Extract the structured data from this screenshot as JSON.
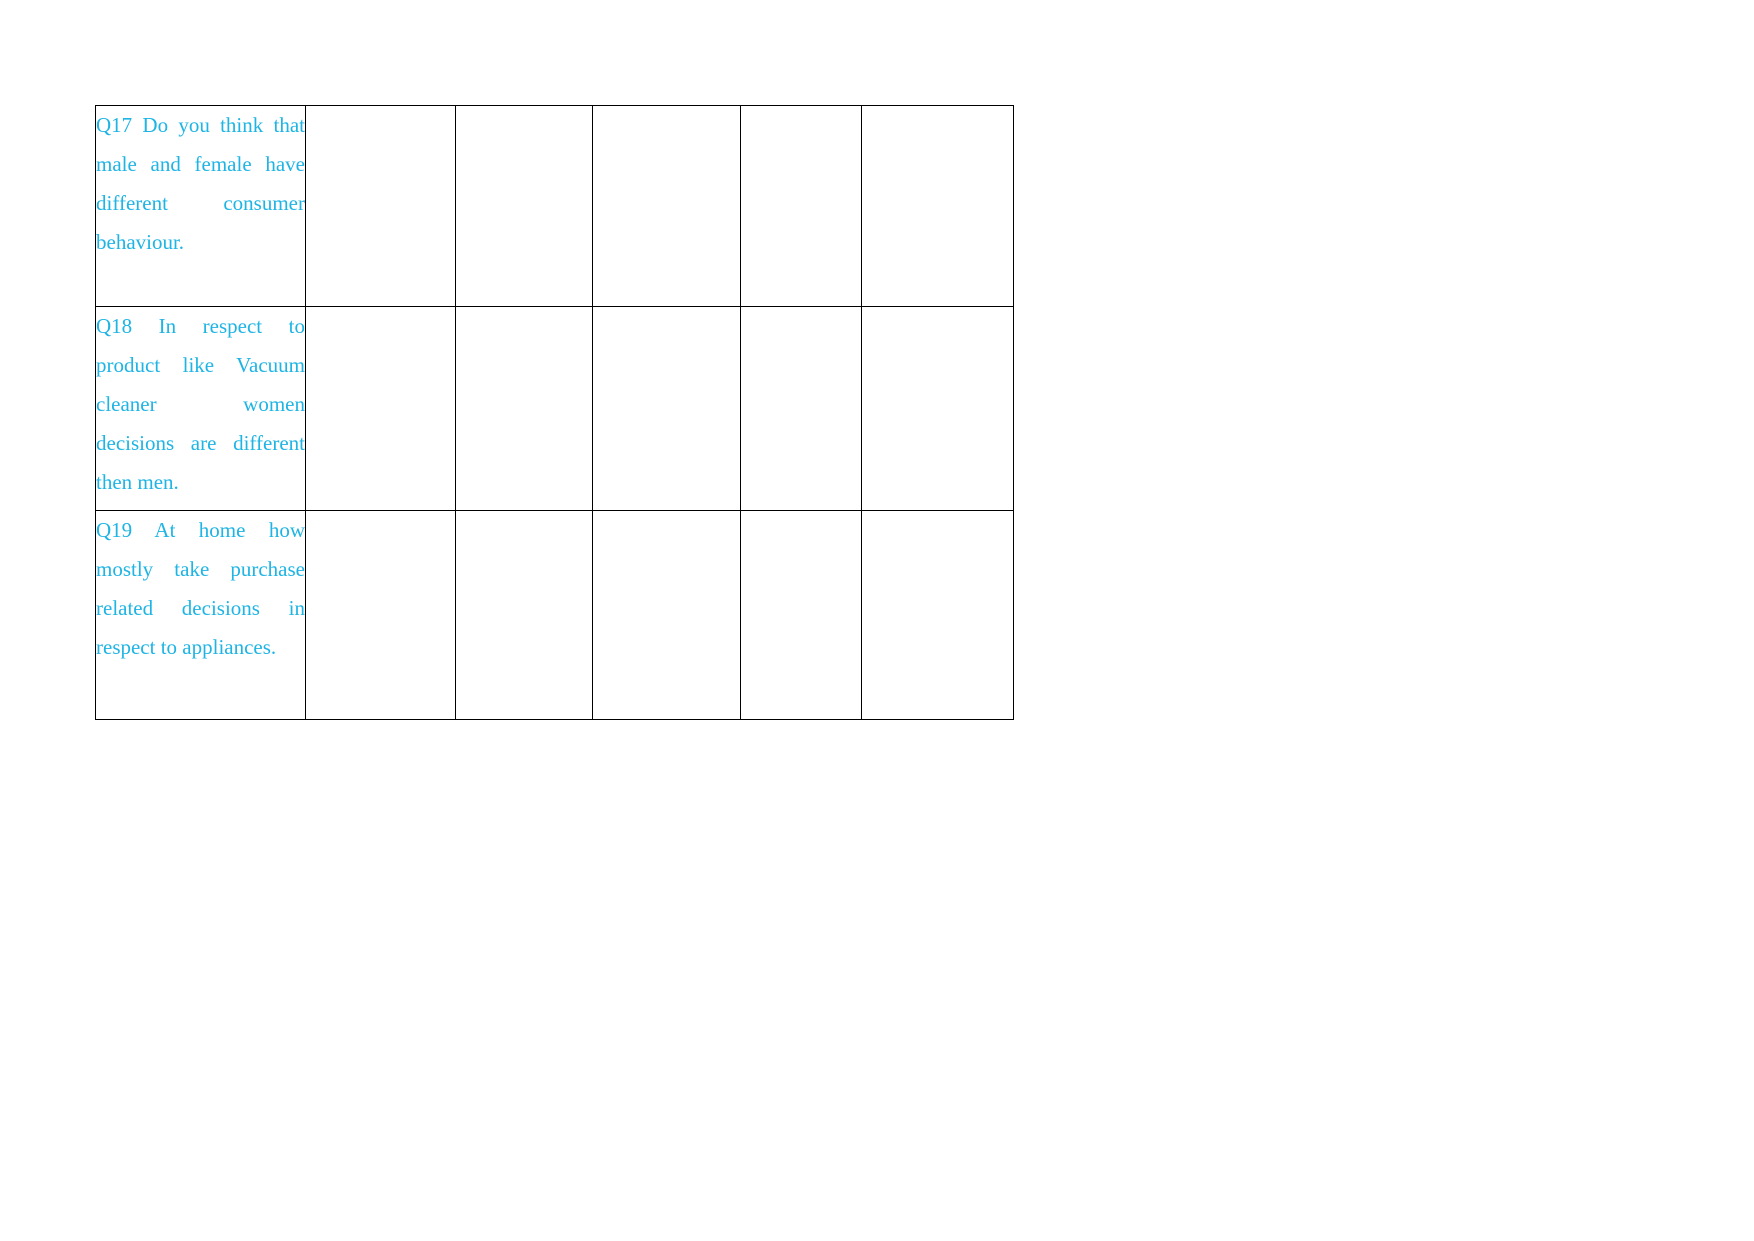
{
  "document": {
    "page_background": "#ffffff",
    "text_color": "#1EB4E4",
    "border_color": "#000000"
  },
  "table": {
    "name": "questionnaire-table",
    "column_count": 6,
    "row_count": 3,
    "rows": [
      {
        "id": "q17",
        "question": "Q17 Do you think that male and female have different consumer behaviour.",
        "answers": [
          "",
          "",
          "",
          "",
          ""
        ]
      },
      {
        "id": "q18",
        "question": "Q18 In respect to product like Vacuum cleaner women decisions are different then men.",
        "answers": [
          "",
          "",
          "",
          "",
          ""
        ]
      },
      {
        "id": "q19",
        "question": "Q19 At home how mostly take purchase related decisions in respect to appliances.",
        "answers": [
          "",
          "",
          "",
          "",
          ""
        ]
      }
    ]
  }
}
